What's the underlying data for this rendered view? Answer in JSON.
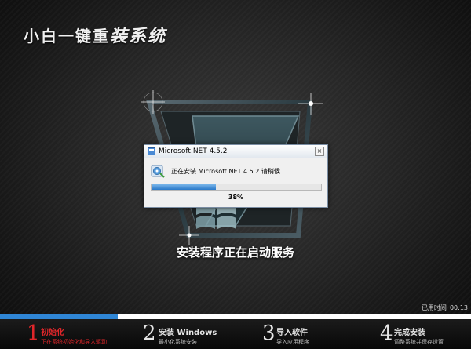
{
  "brand": {
    "prefix": "小白一键重",
    "emphasis": "装系统"
  },
  "status_text": "安装程序正在启动服务",
  "dialog": {
    "title": "Microsoft.NET 4.5.2",
    "close_label": "×",
    "message": "正在安装 Microsoft.NET 4.5.2 请稍候........",
    "progress": 0.38,
    "progress_label": "38%"
  },
  "elapsed": {
    "label": "已用时间",
    "value": "00:13"
  },
  "overall_progress": 0.25,
  "steps": [
    {
      "num": "1",
      "title": "初始化",
      "subtitle": "正在系统初始化和导入驱动",
      "active": true
    },
    {
      "num": "2",
      "title": "安装 Windows",
      "subtitle": "最小化系统安装",
      "active": false
    },
    {
      "num": "3",
      "title": "导入软件",
      "subtitle": "导入应用程序",
      "active": false
    },
    {
      "num": "4",
      "title": "完成安装",
      "subtitle": "调整系统并保存设置",
      "active": false
    }
  ],
  "colors": {
    "accent_red": "#e0262a",
    "progress_blue": "#2f86d6"
  }
}
